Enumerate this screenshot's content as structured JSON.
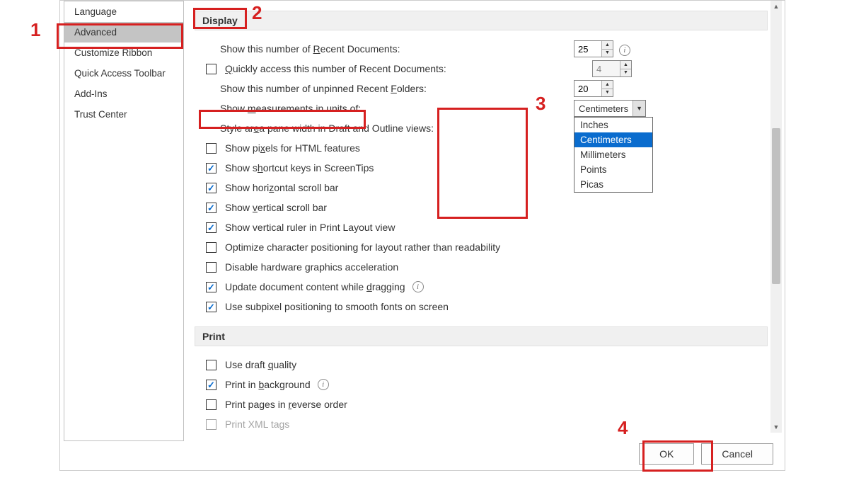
{
  "sidebar": {
    "items": [
      {
        "label": "Language"
      },
      {
        "label": "Advanced"
      },
      {
        "label": "Customize Ribbon"
      },
      {
        "label": "Quick Access Toolbar"
      },
      {
        "label": "Add-Ins"
      },
      {
        "label": "Trust Center"
      }
    ],
    "selected_index": 1
  },
  "sections": {
    "display": {
      "title": "Display"
    },
    "print": {
      "title": "Print"
    }
  },
  "display": {
    "recent_docs_label_pre": "Show this number of ",
    "recent_docs_label_hot": "R",
    "recent_docs_label_post": "ecent Documents:",
    "recent_docs_value": "25",
    "quick_access_label_pre": "Q",
    "quick_access_label_post": "uickly access this number of Recent Documents:",
    "quick_access_value": "4",
    "recent_folders_label_pre": "Show this number of unpinned Recent ",
    "recent_folders_label_hot": "F",
    "recent_folders_label_post": "olders:",
    "recent_folders_value": "20",
    "units_label_pre": "Show ",
    "units_label_hot": "m",
    "units_label_post": "easurements in units of:",
    "units_value": "Centimeters",
    "units_options": [
      "Inches",
      "Centimeters",
      "Millimeters",
      "Points",
      "Picas"
    ],
    "units_selected_index": 1,
    "style_area_label_pre": "Style ar",
    "style_area_label_hot": "e",
    "style_area_label_post": "a pane width in Draft and Outline views:",
    "pixels_label_pre": "Show pi",
    "pixels_label_hot": "x",
    "pixels_label_post": "els for HTML features",
    "shortcut_label_pre": "Show s",
    "shortcut_label_hot": "h",
    "shortcut_label_post": "ortcut keys in ScreenTips",
    "hscroll_label_pre": "Show hori",
    "hscroll_label_hot": "z",
    "hscroll_label_post": "ontal scroll bar",
    "vscroll_label_pre": "Show ",
    "vscroll_label_hot": "v",
    "vscroll_label_post": "ertical scroll bar",
    "vruler_label": "Show vertical ruler in Print Layout view",
    "optimize_label": "Optimize character positioning for layout rather than readability",
    "hw_label_pre": "Disable hardware ",
    "hw_label_hot": "g",
    "hw_label_post": "raphics acceleration",
    "drag_label_pre": "Update document content while ",
    "drag_label_hot": "d",
    "drag_label_post": "ragging",
    "subpixel_label": "Use subpixel positioning to smooth fonts on screen"
  },
  "print": {
    "draft_label_pre": "Use draft ",
    "draft_label_hot": "q",
    "draft_label_post": "uality",
    "bg_label_pre": "Print in ",
    "bg_label_hot": "b",
    "bg_label_post": "ackground",
    "reverse_label_pre": "Print pages in ",
    "reverse_label_hot": "r",
    "reverse_label_post": "everse order",
    "xml_partial": "Print XML tags"
  },
  "buttons": {
    "ok": "OK",
    "cancel": "Cancel"
  },
  "callouts": {
    "n1": "1",
    "n2": "2",
    "n3": "3",
    "n4": "4"
  }
}
